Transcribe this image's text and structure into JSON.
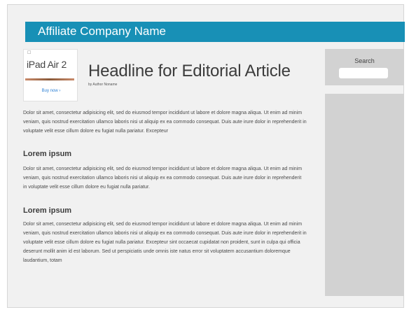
{
  "banner": {
    "title": "Affiliate Company Name"
  },
  "ad": {
    "logo": "",
    "product": "iPad Air 2",
    "cta": "Buy now ›"
  },
  "article": {
    "headline": "Headline for Editorial Article",
    "byline": "by Author Noname",
    "intro": "Dolor sit amet, consectetur adipisicing elit, sed do eiusmod tempor incididunt ut labore et dolore magna aliqua. Ut enim ad minim veniam, quis nostrud exercitation ullamco laboris nisi ut aliquip ex ea commodo consequat. Duis aute irure dolor in reprehenderit in voluptate velit esse cillum dolore eu fugiat nulla pariatur. Excepteur",
    "sections": [
      {
        "heading": "Lorem ipsum",
        "body": "Dolor sit amet, consectetur adipisicing elit, sed do eiusmod tempor incididunt ut labore et dolore magna aliqua. Ut enim ad minim veniam, quis nostrud exercitation ullamco laboris nisi ut aliquip ex ea commodo consequat. Duis aute irure dolor in reprehenderit in voluptate velit esse cillum dolore eu fugiat nulla pariatur."
      },
      {
        "heading": "Lorem ipsum",
        "body": "Dolor sit amet, consectetur adipisicing elit, sed do eiusmod tempor incididunt ut labore et dolore magna aliqua. Ut enim ad minim veniam, quis nostrud exercitation ullamco laboris nisi ut aliquip ex ea commodo consequat. Duis aute irure dolor in reprehenderit in voluptate velit esse cillum dolore eu fugiat nulla pariatur. Excepteur sint occaecat cupidatat non proident, sunt in culpa qui officia deserunt mollit anim id est laborum. Sed ut perspiciatis unde omnis iste natus error sit voluptatem accusantium doloremque laudantium, totam"
      }
    ]
  },
  "sidebar": {
    "search_label": "Search",
    "search_value": "",
    "search_placeholder": ""
  },
  "colors": {
    "banner": "#1890b6",
    "sidebar": "#d2d2d2",
    "page": "#f1f1f1"
  }
}
